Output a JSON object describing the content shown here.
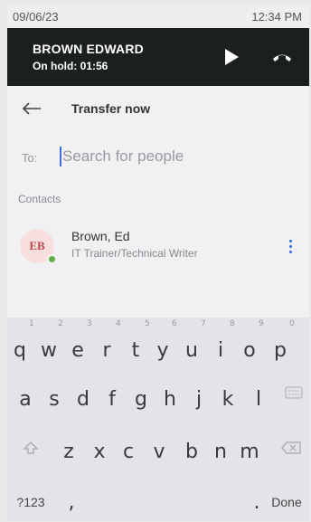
{
  "status_bar": {
    "date": "09/06/23",
    "time": "12:34 PM"
  },
  "call": {
    "name": "BROWN EDWARD",
    "status": "On hold: 01:56",
    "resume_icon": "play-icon",
    "hangup_icon": "hangup-icon"
  },
  "header": {
    "title": "Transfer now",
    "back_icon": "arrow-left-icon"
  },
  "search": {
    "label": "To:",
    "placeholder": "Search for people",
    "value": ""
  },
  "contacts": {
    "section_label": "Contacts",
    "items": [
      {
        "initials": "EB",
        "name": "Brown, Ed",
        "title": "IT Trainer/Technical Writer",
        "presence": "available"
      }
    ]
  },
  "keyboard": {
    "row1": [
      "q",
      "w",
      "e",
      "r",
      "t",
      "y",
      "u",
      "i",
      "o",
      "p"
    ],
    "row1_hints": [
      "1",
      "2",
      "3",
      "4",
      "5",
      "6",
      "7",
      "8",
      "9",
      "0"
    ],
    "row2": [
      "a",
      "s",
      "d",
      "f",
      "g",
      "h",
      "j",
      "k",
      "l"
    ],
    "row3": [
      "z",
      "x",
      "c",
      "v",
      "b",
      "n",
      "m"
    ],
    "symbols_label": "?123",
    "comma": ",",
    "period": ".",
    "done_label": "Done"
  },
  "colors": {
    "call_bar": "#1b1f1d",
    "accent": "#2f6be0",
    "presence_available": "#5fb24a",
    "avatar_bg": "#f7dfe0"
  }
}
